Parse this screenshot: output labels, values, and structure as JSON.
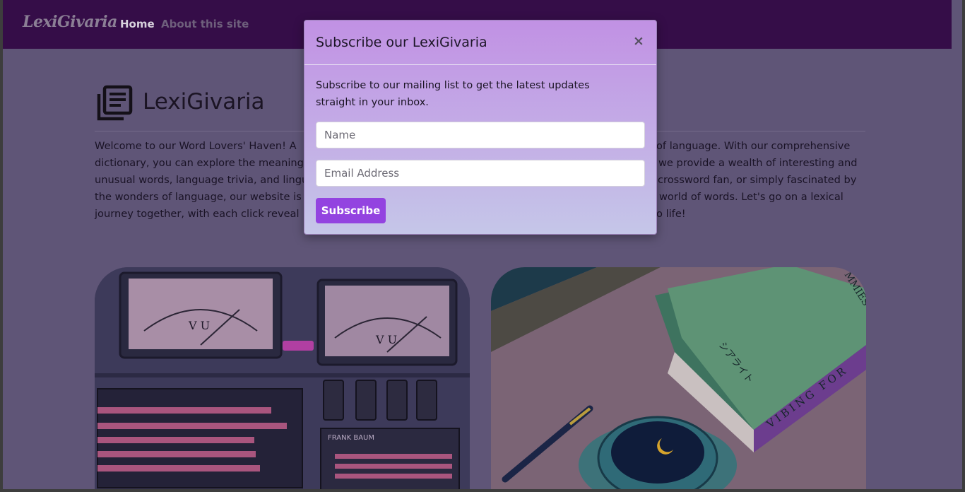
{
  "navbar": {
    "brand": "LexiGivaria",
    "links": [
      "Home",
      "About this site"
    ]
  },
  "page": {
    "title": "LexiGivaria",
    "intro_visible": [
      "Welcome to our Word Lovers' Haven! A",
      "of language. With our comprehensive",
      "dictionary, you can explore the meanings",
      "we provide a wealth of interesting and",
      "unusual words, language trivia, and lingui",
      "crossword fan, or simply fascinated by",
      "the wonders of language, our website is",
      "world of words. Let's go on a lexical",
      "journey together, with each click reveal",
      "o life!"
    ]
  },
  "images": {
    "left": {
      "meter_labels": [
        "V U",
        "V U",
        "FRANK BAUM"
      ]
    },
    "right": {
      "book_texts": [
        "MMIES",
        "シアライト",
        "VIBING FOR"
      ]
    }
  },
  "modal": {
    "title": "Subscribe our LexiGivaria",
    "close_label": "×",
    "text": "Subscribe to our mailing list to get the latest updates straight in your inbox.",
    "name_placeholder": "Name",
    "email_placeholder": "Email Address",
    "button_label": "Subscribe"
  },
  "colors": {
    "navbar": "#350d48",
    "modal_top": "#c191e4",
    "modal_bottom": "#c5c6e8",
    "subscribe_button": "#9343e0",
    "backdrop": "#5f5577"
  }
}
